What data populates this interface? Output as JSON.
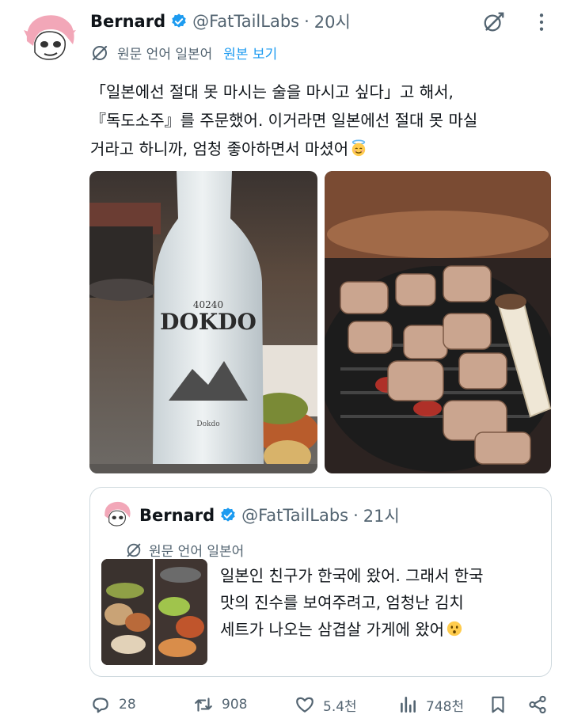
{
  "tweet": {
    "author_name": "Bernard",
    "handle": "@FatTailLabs",
    "separator": "·",
    "time": "20시",
    "translation": {
      "label": "원문 언어 일본어",
      "link": "원본 보기"
    },
    "text_lines": [
      "「일본에선 절대 못 마시는 술을 마시고 싶다」고 해서,",
      "『독도소주』를 주문했어. 이거라면 일본에선 절대 못 마실",
      "거라고 하니까, 엄청 좋아하면서 마셨어"
    ],
    "emoji": "innocent-smiling-face-emoji",
    "photos": [
      {
        "label_small": "40240",
        "label_big": "DOKDO",
        "label_bottom": "Dokdo"
      },
      {
        "label": "grilled-pork-on-grill"
      }
    ]
  },
  "quote": {
    "author_name": "Bernard",
    "handle": "@FatTailLabs",
    "separator": "·",
    "time": "21시",
    "translation_label": "원문 언어 일본어",
    "text_lines": [
      "일본인 친구가 한국에 왔어. 그래서 한국",
      "맛의 진수를 보여주려고, 엄청난 김치",
      "세트가 나오는 삼겹살 가게에 왔어"
    ],
    "emoji": "hushed-face-emoji"
  },
  "actions": {
    "replies": "28",
    "retweets": "908",
    "likes": "5.4천",
    "views": "748천"
  },
  "colors": {
    "text": "#0f1419",
    "secondary": "#536471",
    "link": "#1d9bf0",
    "verified": "#1d9bf0",
    "border": "#cfd9de"
  },
  "icons": [
    "verified-badge-icon",
    "grok-icon",
    "more-icon",
    "translate-icon",
    "reply-icon",
    "retweet-icon",
    "like-icon",
    "views-icon",
    "bookmark-icon",
    "share-icon"
  ]
}
